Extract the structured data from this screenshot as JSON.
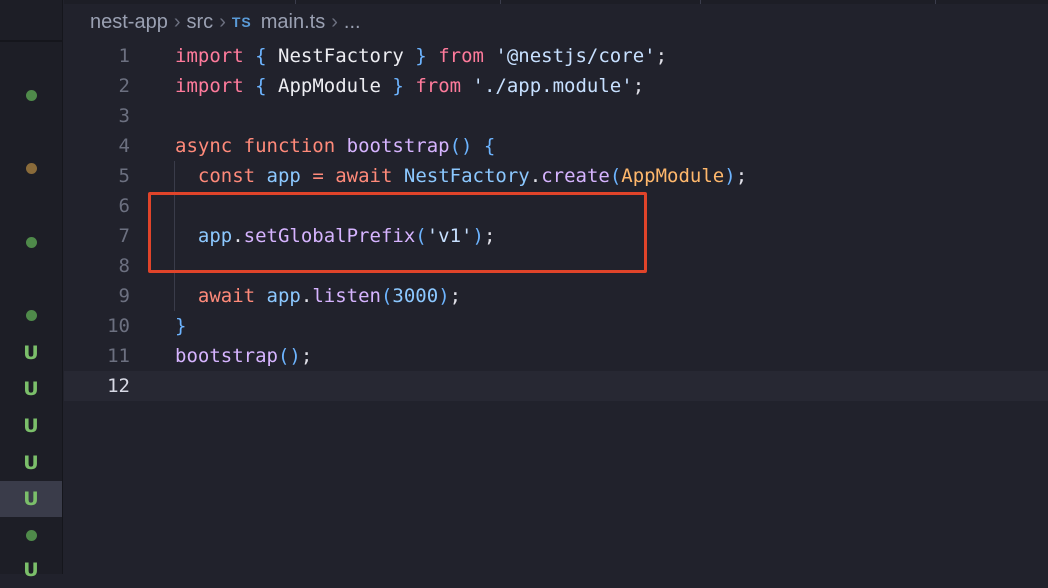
{
  "breadcrumb": {
    "project": "nest-app",
    "folder": "src",
    "file_type_label": "TS",
    "file": "main.ts",
    "more": "..."
  },
  "git_status": {
    "dot_colors": [
      "#4f8a4a",
      "#8a6b3a",
      "#4f8a4a",
      "#4f8a4a",
      "#4f8a4a"
    ],
    "untracked_label": "U"
  },
  "code_lines": [
    {
      "n": "1"
    },
    {
      "n": "2"
    },
    {
      "n": "3"
    },
    {
      "n": "4"
    },
    {
      "n": "5"
    },
    {
      "n": "6"
    },
    {
      "n": "7"
    },
    {
      "n": "8"
    },
    {
      "n": "9"
    },
    {
      "n": "10"
    },
    {
      "n": "11"
    },
    {
      "n": "12"
    }
  ],
  "tokens": {
    "import": "import",
    "ob": "{",
    "cb": "}",
    "from": "from",
    "nestfactory": "NestFactory",
    "core_str": "'@nestjs/core'",
    "semi": ";",
    "appmodule": "AppModule",
    "appmodule_str": "'./app.module'",
    "async": "async",
    "function": "function",
    "bootstrap": "bootstrap",
    "parens": "()",
    "const": "const",
    "app": "app",
    "eq": "=",
    "await": "await",
    "dot": ".",
    "create": "create",
    "lp": "(",
    "rp": ")",
    "setGlobalPrefix": "setGlobalPrefix",
    "v1_str": "'v1'",
    "listen": "listen",
    "port": "3000"
  },
  "colors": {
    "highlight_box": "#e0442a",
    "keyword": "#ff7b9c",
    "function_name": "#d6b4ff"
  }
}
